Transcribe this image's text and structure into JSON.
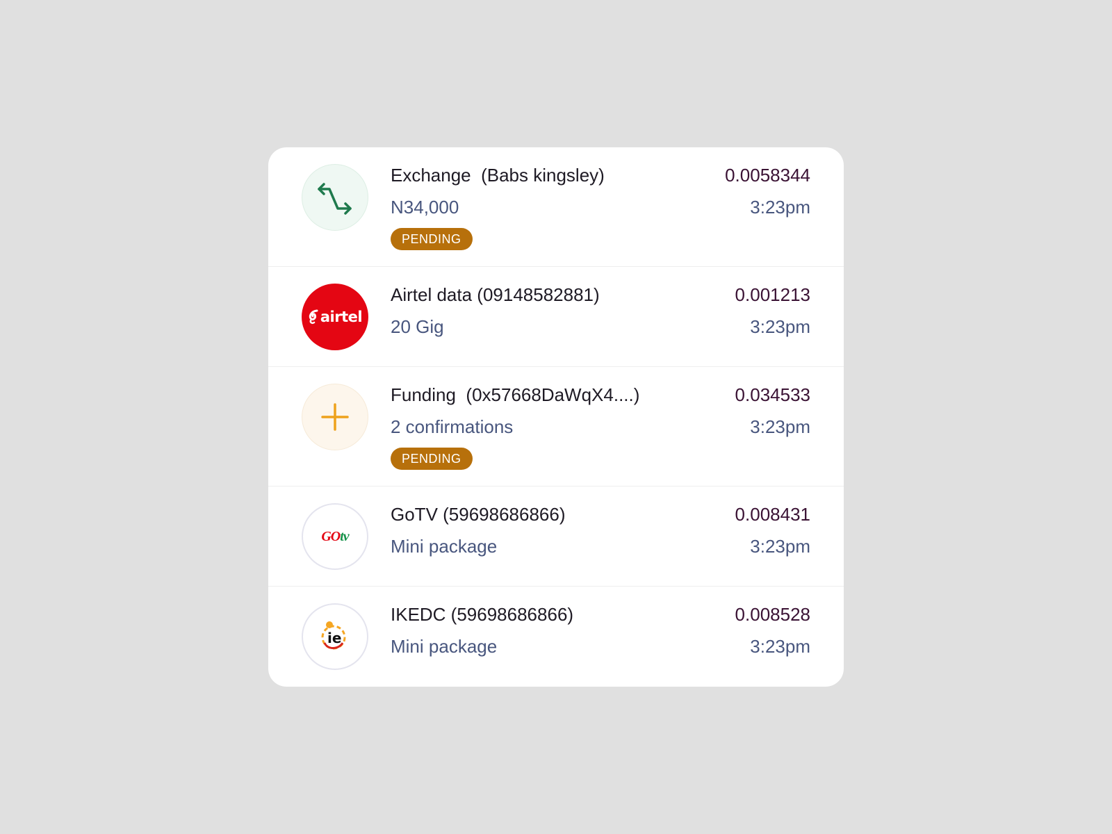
{
  "transactions": [
    {
      "icon": "exchange-arrows-icon",
      "title": "Exchange  (Babs kingsley)",
      "subtitle": "N34,000",
      "amount": "0.0058344",
      "time": "3:23pm",
      "badge": "PENDING"
    },
    {
      "icon": "airtel-logo",
      "logo_text": "airtel",
      "title": "Airtel data (09148582881)",
      "subtitle": "20 Gig",
      "amount": "0.001213",
      "time": "3:23pm"
    },
    {
      "icon": "plus-icon",
      "title": "Funding  (0x57668DaWqX4....)",
      "subtitle": "2 confirmations",
      "amount": "0.034533",
      "time": "3:23pm",
      "badge": "PENDING"
    },
    {
      "icon": "gotv-logo",
      "logo_text_1": "GO",
      "logo_text_2": "tv",
      "title": "GoTV (59698686866)",
      "subtitle": "Mini package",
      "amount": "0.008431",
      "time": "3:23pm"
    },
    {
      "icon": "ikeja-electric-logo",
      "logo_text": "ie",
      "title": "IKEDC (59698686866)",
      "subtitle": "Mini package",
      "amount": "0.008528",
      "time": "3:23pm"
    }
  ],
  "colors": {
    "background": "#e0e0e0",
    "card": "#ffffff",
    "badge": "#b7700b",
    "exchange_icon": "#1f7a4d",
    "funding_icon": "#eea21c",
    "airtel_red": "#e40613",
    "amount_text": "#3a1234",
    "secondary_text": "#48567e"
  }
}
